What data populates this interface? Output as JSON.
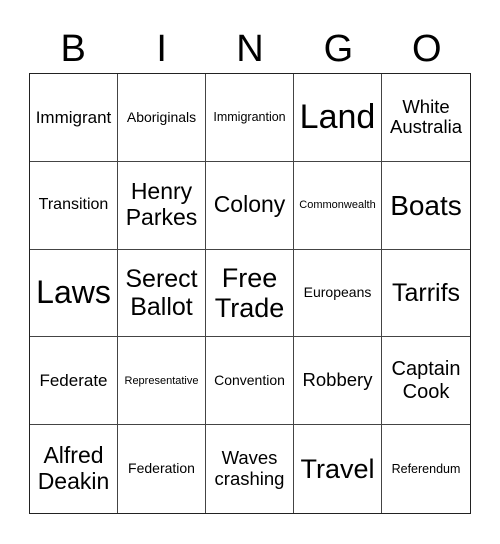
{
  "header": {
    "letters": [
      "B",
      "I",
      "N",
      "G",
      "O"
    ]
  },
  "grid": {
    "rows": [
      [
        "Immigrant",
        "Aboriginals",
        "Immigrantion",
        "Land",
        "White Australia"
      ],
      [
        "Transition",
        "Henry Parkes",
        "Colony",
        "Commonwealth",
        "Boats"
      ],
      [
        "Laws",
        "Serect Ballot",
        "Free Trade",
        "Europeans",
        "Tarrifs"
      ],
      [
        "Federate",
        "Representative",
        "Convention",
        "Robbery",
        "Captain Cook"
      ],
      [
        "Alfred Deakin",
        "Federation",
        "Waves crashing",
        "Travel",
        "Referendum"
      ]
    ]
  }
}
